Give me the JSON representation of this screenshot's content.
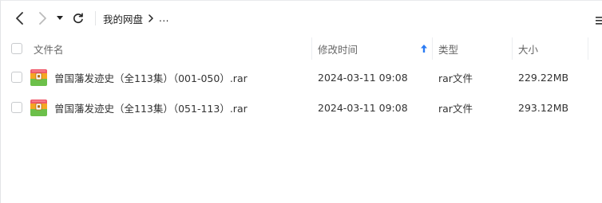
{
  "breadcrumb": {
    "root": "我的网盘",
    "more": "..."
  },
  "columns": {
    "name": "文件名",
    "modified": "修改时间",
    "type": "类型",
    "size": "大小"
  },
  "files": [
    {
      "name": "曾国藩发迹史（全113集）（001-050）.rar",
      "modified": "2024-03-11 09:08",
      "type": "rar文件",
      "size": "229.22MB",
      "icon": "archive-file-icon"
    },
    {
      "name": "曾国藩发迹史（全113集）（051-113）.rar",
      "modified": "2024-03-11 09:08",
      "type": "rar文件",
      "size": "293.12MB",
      "icon": "archive-file-icon"
    }
  ],
  "colors": {
    "sort_arrow": "#2b7bf3",
    "divider": "#eceef1"
  }
}
